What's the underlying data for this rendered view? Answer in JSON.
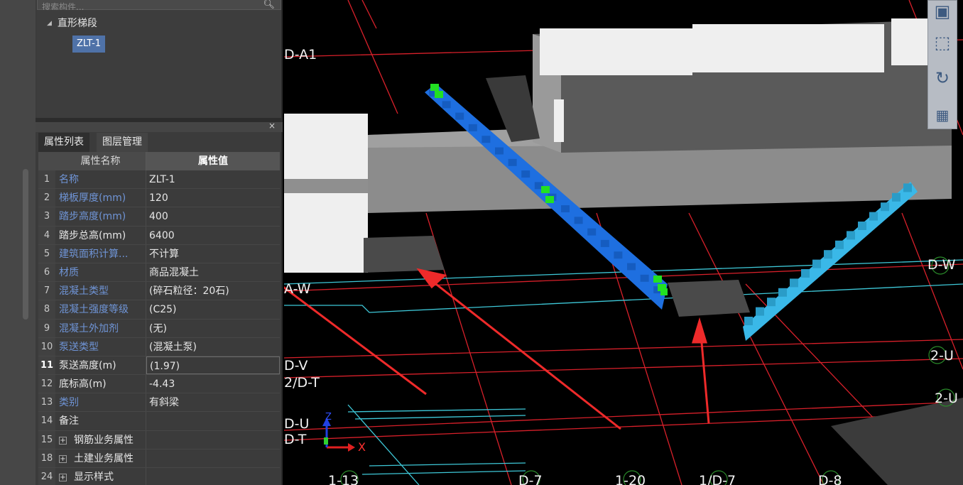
{
  "search": {
    "placeholder": "搜索构件..."
  },
  "tree": {
    "node": "直形梯段",
    "leaf": "ZLT-1"
  },
  "tabs": [
    "属性列表",
    "图层管理"
  ],
  "table": {
    "col_name": "属性名称",
    "col_value": "属性值",
    "rows": [
      {
        "num": "1",
        "name": "名称",
        "value": "ZLT-1",
        "blue": true
      },
      {
        "num": "2",
        "name": "梯板厚度(mm)",
        "value": "120",
        "blue": true
      },
      {
        "num": "3",
        "name": "踏步高度(mm)",
        "value": "400",
        "blue": true
      },
      {
        "num": "4",
        "name": "踏步总高(mm)",
        "value": "6400",
        "blue": false
      },
      {
        "num": "5",
        "name": "建筑面积计算...",
        "value": "不计算",
        "blue": true
      },
      {
        "num": "6",
        "name": "材质",
        "value": "商品混凝土",
        "blue": true
      },
      {
        "num": "7",
        "name": "混凝土类型",
        "value": "(碎石粒径：20石)",
        "blue": true
      },
      {
        "num": "8",
        "name": "混凝土强度等级",
        "value": "(C25)",
        "blue": true
      },
      {
        "num": "9",
        "name": "混凝土外加剂",
        "value": "(无)",
        "blue": true
      },
      {
        "num": "10",
        "name": "泵送类型",
        "value": "(混凝土泵)",
        "blue": true
      },
      {
        "num": "11",
        "name": "泵送高度(m)",
        "value": "(1.97)",
        "blue": false,
        "selected": true
      },
      {
        "num": "12",
        "name": "底标高(m)",
        "value": "-4.43",
        "blue": false
      },
      {
        "num": "13",
        "name": "类别",
        "value": "有斜梁",
        "blue": true
      },
      {
        "num": "14",
        "name": "备注",
        "value": "",
        "blue": false
      },
      {
        "num": "15",
        "name": "钢筋业务属性",
        "value": "",
        "blue": false,
        "group": true
      },
      {
        "num": "18",
        "name": "土建业务属性",
        "value": "",
        "blue": false,
        "group": true
      },
      {
        "num": "24",
        "name": "显示样式",
        "value": "",
        "blue": false,
        "group": true
      }
    ]
  },
  "viewport": {
    "grid_labels": {
      "da1": "D-A1",
      "aw": "A-W",
      "dw": "D-W",
      "dv": "D-V",
      "dt2": "2/D-T",
      "du": "D-U",
      "du2": "2-U",
      "du3": "2-U",
      "dt": "D-T",
      "l113": "1-13",
      "d7": "D-7",
      "l120": "1-20",
      "d17": "1/D-7",
      "d8": "D-8"
    },
    "axes": {
      "x": "X",
      "z": "Z"
    },
    "colors": {
      "grid_red": "#d8202a",
      "grid_cyan": "#3ec8d8",
      "stair_blue": "#1e6fe0",
      "stair_cyan": "#3ab8e8",
      "marker_green": "#22e022",
      "slab_gray": "#8c8c8c",
      "wall_white": "#efefef",
      "arrow_red": "#ee2a2a"
    }
  },
  "viewcube": {
    "icons": [
      "view-cube-icon",
      "box-3d-icon",
      "rotate-icon",
      "layout-icon"
    ]
  }
}
